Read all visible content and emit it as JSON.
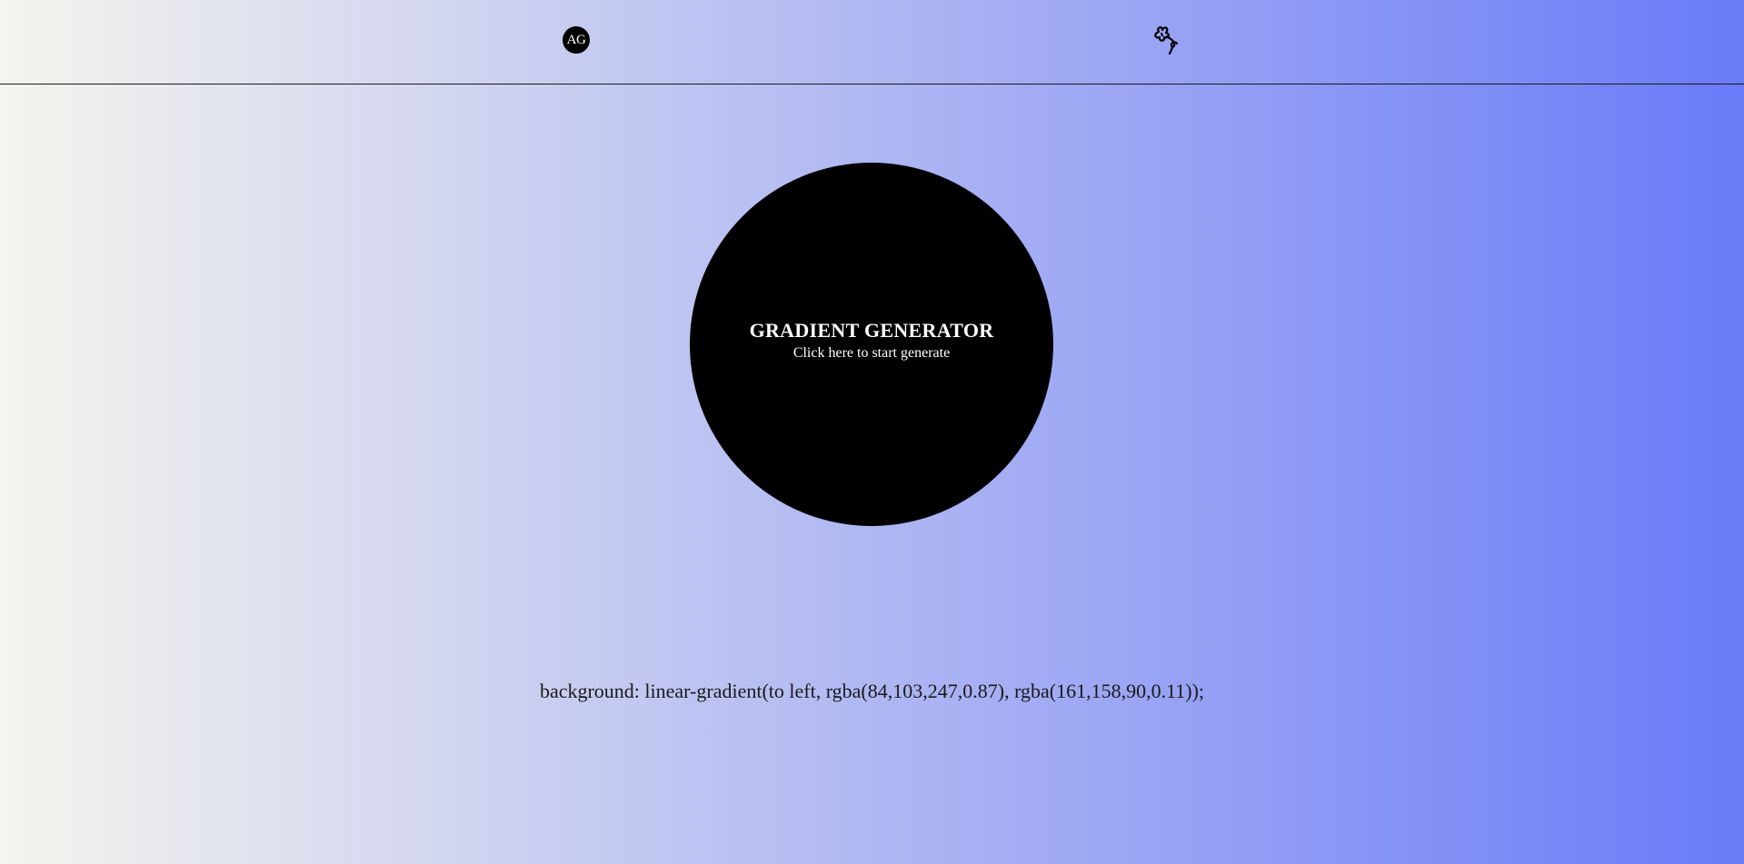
{
  "header": {
    "logo_text": "AG",
    "icon": "flower-icon"
  },
  "hero": {
    "title": "GRADIENT GENERATOR",
    "subtitle": "Click here to start generate"
  },
  "output": {
    "css_text": "background: linear-gradient(to left, rgba(84,103,247,0.87), rgba(161,158,90,0.11));"
  },
  "colors": {
    "gradient_start": "rgba(161,158,90,0.11)",
    "gradient_end": "rgba(84,103,247,0.87)",
    "button_bg": "#000000",
    "button_text": "#ffffff"
  }
}
